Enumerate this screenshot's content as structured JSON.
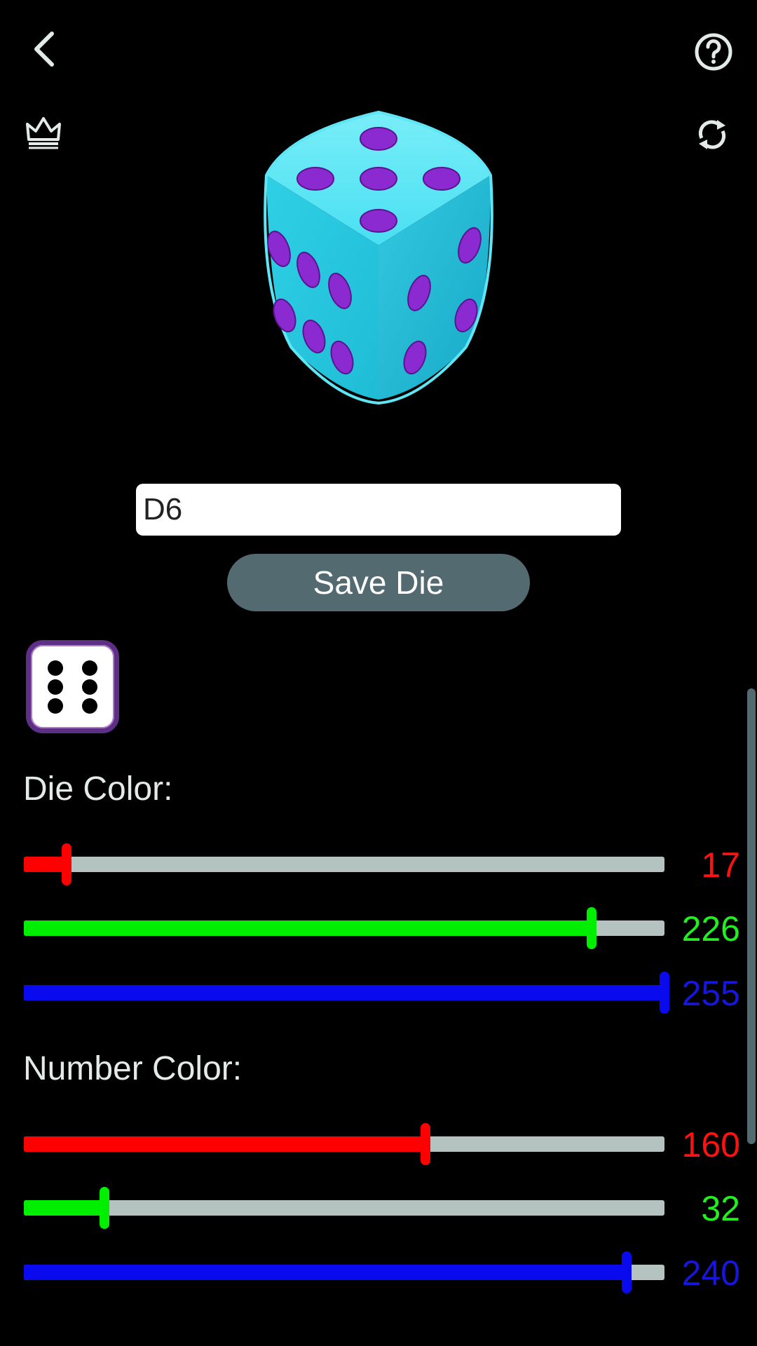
{
  "die_name_value": "D6",
  "save_label": "Save Die",
  "die_color_label": "Die Color:",
  "number_color_label": "Number Color:",
  "die_color": {
    "r": 17,
    "g": 226,
    "b": 255
  },
  "number_color": {
    "r": 160,
    "g": 32,
    "b": 240
  },
  "die_type": "D6",
  "icons": [
    "back-arrow-icon",
    "help-icon",
    "crown-icon",
    "rotate-icon"
  ],
  "colors": {
    "background": "#000000",
    "button": "#546a71",
    "track": "#b4c2c0"
  }
}
